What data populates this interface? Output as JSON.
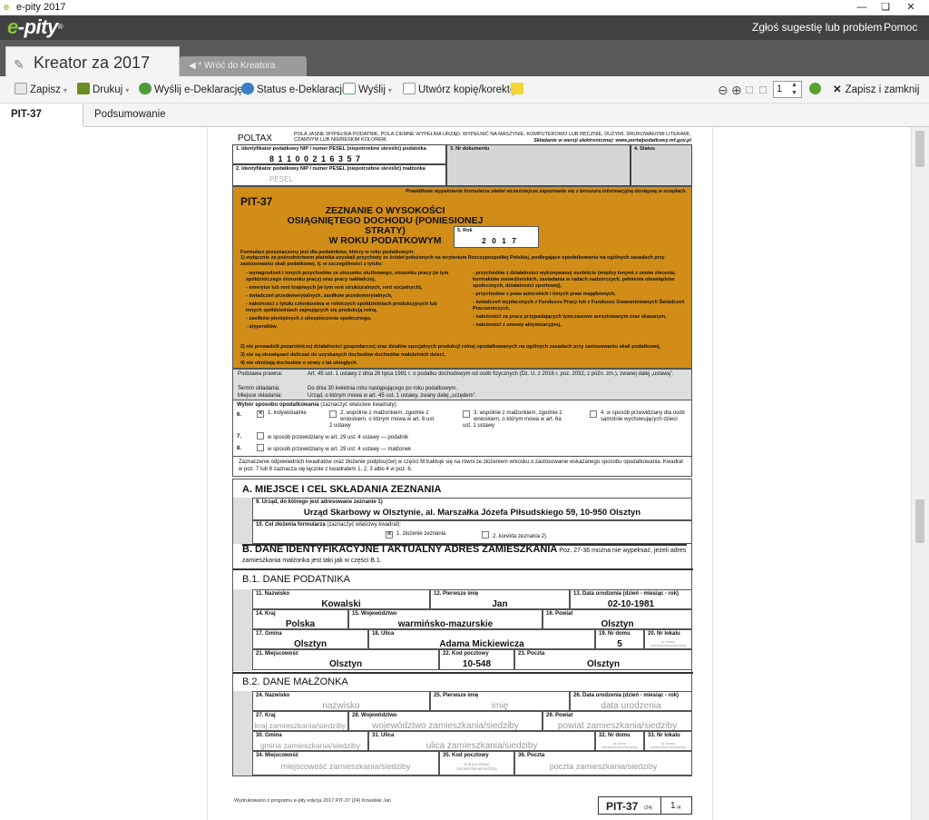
{
  "window": {
    "title": "e-pity 2017",
    "logo": "e"
  },
  "brandbar": {
    "brand_prefix": "e",
    "brand_suffix": "-pity",
    "reg": "®",
    "menu": [
      "Zgłoś sugestię lub problem",
      "Pomoc"
    ]
  },
  "tabs": {
    "main": "Kreator za 2017",
    "back": "◀  * Wróć do Kreatora"
  },
  "toolbar": {
    "save": "Zapisz",
    "print": "Drukuj",
    "send_edecl": "Wyślij e-Deklarację",
    "status_edecl": "Status e-Deklaracji",
    "send": "Wyślij",
    "copy": "Utwórz kopię/korektę",
    "page": "1",
    "save_close": "Zapisz i zamknij"
  },
  "subtabs": [
    "PIT-37 (24)",
    "Podsumowanie"
  ],
  "form": {
    "poltax": "POLTAX",
    "header_note": "POLA JASNE WYPEŁNIA PODATNIK, POLA CIEMNE WYPEŁNIA URZĄD. WYPEŁNIĆ NA MASZYNIE, KOMPUTEROWO LUB RĘCZNIE, DUŻYMI, DRUKOWANYMI LITERAMI, CZARNYM LUB NIEBIESKIM KOLOREM.",
    "header_note2": "Składanie w wersji elektronicznej: www.portalpodatkowy.mf.gov.pl",
    "f1_label": "1. Identyfikator podatkowy NIP / numer PESEL (niepotrzebne skreślić) podatnika",
    "f1_value": "8 1 1 0 0 2 1 6 3 5 7",
    "f2_label": "2. Identyfikator podatkowy NIP / numer PESEL (niepotrzebne skreślić) małżonka",
    "f2_value": "PESEL",
    "f3_label": "3. Nr dokumentu",
    "f4_label": "4. Status",
    "orange_note": "Prawidłowe wypełnienie formularza ułatwi wcześniejsze zapoznanie się z broszurą informacyjną dostępną w urzędach.",
    "form_code": "PIT-37",
    "title_line1": "ZEZNANIE O WYSOKOŚCI",
    "title_line2": "OSIĄGNIĘTEGO DOCHODU (PONIESIONEJ STRATY)",
    "title_line3": "W ROKU PODATKOWYM",
    "year_label": "5. Rok",
    "year_value": "2 0 1 7",
    "intro": "Formularz przeznaczony jest dla podatników, którzy w roku podatkowym:",
    "intro1": "1) wyłącznie za pośrednictwem płatnika uzyskali przychody ze źródeł położonych na terytorium Rzeczypospolitej Polskiej, podlegające opodatkowaniu na ogólnych zasadach przy zastosowaniu skali podatkowej, tj. w szczególności z tytułu:",
    "left_items": [
      "- wynagrodzeń i innych przychodów ze stosunku służbowego, stosunku pracy (w tym spółdzielczego stosunku pracy) oraz pracy nakładczej,",
      "- emerytur lub rent krajowych (w tym rent strukturalnych, rent socjalnych),",
      "- świadczeń przedemerytalnych, zasiłków przedemerytalnych,",
      "- należności z tytułu członkostwa w rolniczych spółdzielniach produkcyjnych lub innych spółdzielniach zajmujących się produkcją rolną,",
      "- zasiłków pieniężnych z ubezpieczenia społecznego,",
      "- stypendiów,"
    ],
    "right_items": [
      "- przychodów z działalności wykonywanej osobiście (między innymi z umów zlecenia, kontraktów menedżerskich, zasiadania w radach nadzorczych, pełnienia obowiązków społecznych, działalności sportowej),",
      "- przychodów z praw autorskich i innych praw majątkowych,",
      "- świadczeń wypłaconych z Funduszu Pracy lub z Funduszu Gwarantowanych Świadczeń Pracowniczych,",
      "- należności za pracę przypadających tymczasowo aresztowanym oraz skazanym,",
      "- należności z umowy aktywizacyjnej,"
    ],
    "intro2": "2) nie prowadzili pozarolniczej działalności gospodarczej oraz działów specjalnych produkcji rolnej opodatkowanych na ogólnych zasadach przy zastosowaniu skali podatkowej,",
    "intro3": "3) nie są obowiązani doliczać do uzyskanych dochodów dochodów małoletnich dzieci,",
    "intro4": "4) nie obniżają dochodów o straty z lat ubiegłych.",
    "legal_label": "Podstawa prawna:",
    "legal_text": "Art. 45 ust. 1 ustawy z dnia 26 lipca 1991 r. o podatku dochodowym od osób fizycznych (Dz. U. z 2016 r. poz. 2032, z późn. zm.), zwanej dalej „ustawą”.",
    "deadline_label": "Termin składania:",
    "deadline_text": "Do dnia 30 kwietnia roku następującego po roku podatkowym.",
    "place_label": "Miejsce składania:",
    "place_text": "Urząd, o którym mowa w art. 45 ust. 1 ustawy, zwany dalej „urzędem”.",
    "method_title": "Wybór sposobu opodatkowania",
    "method_hint": "(zaznaczyć właściwe kwadraty):",
    "m6": "6.",
    "m6_opt1": "1. indywidualnie",
    "m6_opt2": "2. wspólnie z małżonkiem, zgodnie z wnioskiem, o którym mowa w art. 6 ust. 2 ustawy",
    "m6_opt3": "3. wspólnie z małżonkiem, zgodnie z wnioskiem, o którym mowa w art. 6a ust. 1 ustawy",
    "m6_opt4": "4. w sposób przewidziany dla osób samotnie wychowujących dzieci",
    "m7": "7.",
    "m7_text": "w sposób przewidziany w art. 29 ust. 4 ustawy — podatnik",
    "m8": "8.",
    "m8_text": "w sposób przewidziany w art. 29 ust. 4 ustawy — małżonek",
    "method_note": "Zaznaczenie odpowiednich kwadratów oraz złożenie podpisu(ów) w części M traktuje się na równi ze złożeniem wniosku o zastosowanie wskazanego sposobu opodatkowania. Kwadrat w poz. 7 lub 8 zaznacza się łącznie z kwadratem 1, 2, 3 albo 4 w poz. 6.",
    "secA": "A. MIEJSCE I CEL SKŁADANIA ZEZNANIA",
    "f9_label": "9. Urząd, do którego jest adresowane zeznanie 1)",
    "f9_value": "Urząd Skarbowy w Olsztynie, al. Marszałka Józefa Piłsudskiego 59, 10-950 Olsztyn",
    "f10_label": "10. Cel złożenia formularza",
    "f10_hint": "(zaznaczyć właściwy kwadrat):",
    "f10_opt1": "1. złożenie zeznania",
    "f10_opt2": "2. korekta zeznania 2)",
    "secB": "B. DANE IDENTYFIKACYJNE I AKTUALNY ADRES ZAMIESZKANIA",
    "secB_note": "Poz. 27-36 można nie wypełniać, jeżeli adres zamieszkania małżonka jest taki jak w części B.1.",
    "secB1": "B.1. DANE PODATNIKA",
    "secB2": "B.2. DANE MAŁŻONKA",
    "b1": {
      "f11": {
        "label": "11. Nazwisko",
        "value": "Kowalski"
      },
      "f12": {
        "label": "12. Pierwsze imię",
        "value": "Jan"
      },
      "f13": {
        "label": "13. Data urodzenia (dzień - miesiąc - rok)",
        "value": "02-10-1981"
      },
      "f14": {
        "label": "14. Kraj",
        "value": "Polska"
      },
      "f15": {
        "label": "15. Województwo",
        "value": "warmińsko-mazurskie"
      },
      "f16": {
        "label": "16. Powiat",
        "value": "Olsztyn"
      },
      "f17": {
        "label": "17. Gmina",
        "value": "Olsztyn"
      },
      "f18": {
        "label": "18. Ulica",
        "value": "Adama Mickiewicza"
      },
      "f19": {
        "label": "19. Nr domu",
        "value": "5"
      },
      "f20": {
        "label": "20. Nr lokalu",
        "value": "nr lokalu zamieszkania/siedziby"
      },
      "f21": {
        "label": "21. Miejscowość",
        "value": "Olsztyn"
      },
      "f22": {
        "label": "22. Kod pocztowy",
        "value": "10-548"
      },
      "f23": {
        "label": "23. Poczta",
        "value": "Olsztyn"
      }
    },
    "b2": {
      "f24": {
        "label": "24. Nazwisko",
        "value": "nazwisko"
      },
      "f25": {
        "label": "25. Pierwsze imię",
        "value": "imię"
      },
      "f26": {
        "label": "26. Data urodzenia (dzień - miesiąc - rok)",
        "value": "data urodzenia"
      },
      "f27": {
        "label": "27. Kraj",
        "value": "kraj zamieszkania/siedziby"
      },
      "f28": {
        "label": "28. Województwo",
        "value": "województwo zamieszkania/siedziby"
      },
      "f29": {
        "label": "29. Powiat",
        "value": "powiat zamieszkania/siedziby"
      },
      "f30": {
        "label": "30. Gmina",
        "value": "gmina zamieszkania/siedziby"
      },
      "f31": {
        "label": "31. Ulica",
        "value": "ulica zamieszkania/siedziby"
      },
      "f32": {
        "label": "32. Nr domu",
        "value": "nr domu zamieszkania/siedziby"
      },
      "f33": {
        "label": "33. Nr lokalu",
        "value": "nr lokalu zamieszkania/siedziby"
      },
      "f34": {
        "label": "34. Miejscowość",
        "value": "miejscowość zamieszkania/siedziby"
      },
      "f35": {
        "label": "35. Kod pocztowy",
        "value": "kod pocztowy zamieszkania/siedziby"
      },
      "f36": {
        "label": "36. Poczta",
        "value": "poczta zamieszkania/siedziby"
      }
    },
    "footer_left": "Wydrukowano z programu e-pity edycja 2017  PIT-37 (24) Kowalski Jan",
    "footer_code": "PIT-37",
    "footer_ver": "(24)",
    "footer_page": "1",
    "footer_pages": "/4"
  },
  "colors": {
    "brand_green": "#8dc63f",
    "form_orange": "#d18d18",
    "dark_bar": "#424242"
  }
}
